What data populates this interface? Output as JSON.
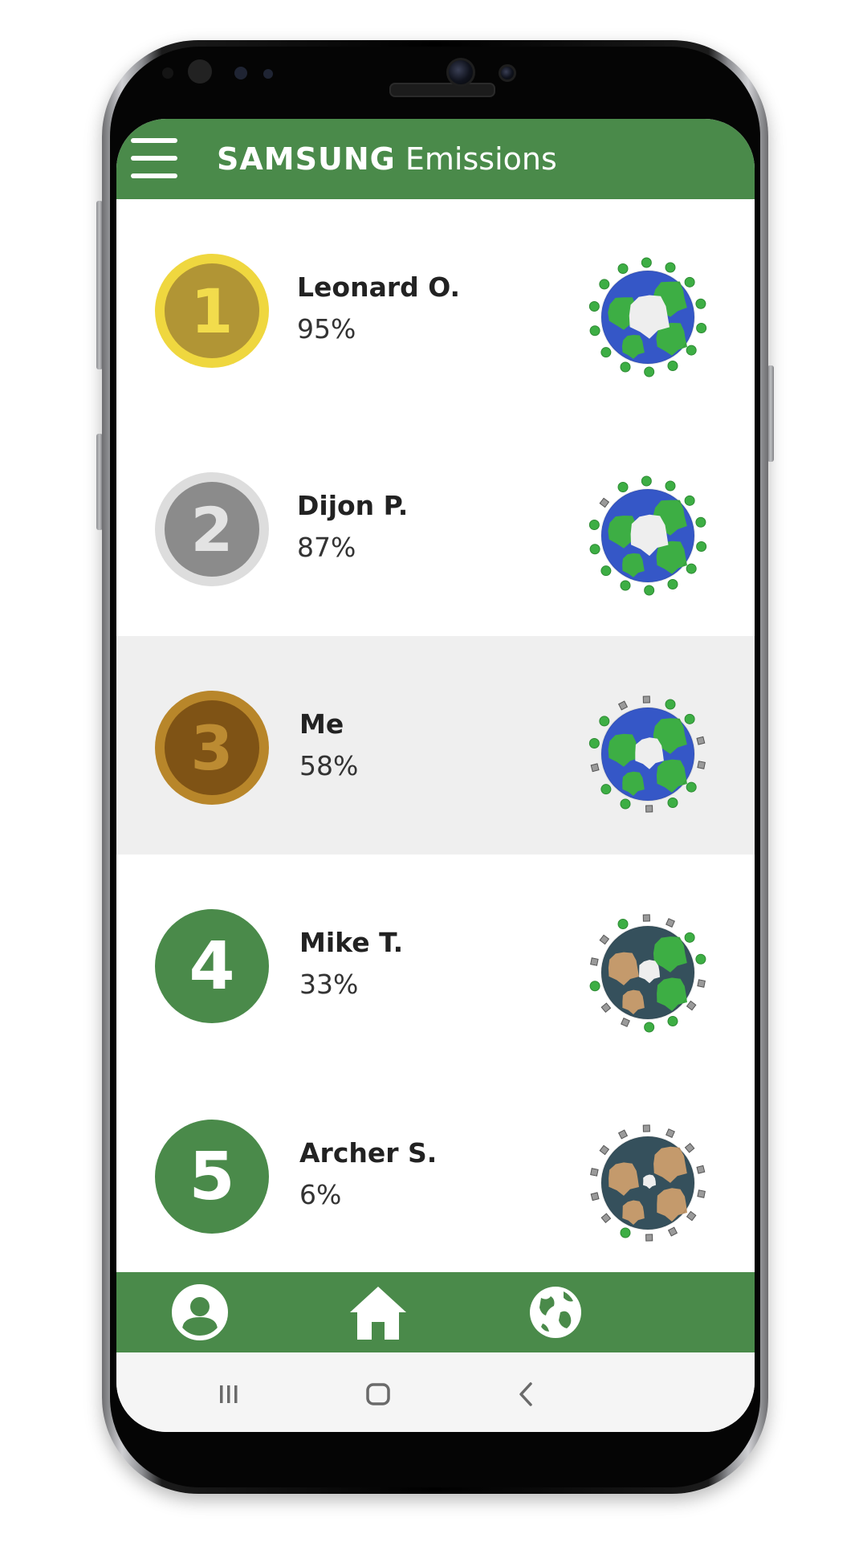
{
  "header": {
    "brand": "SAMSUNG",
    "title": "Emissions",
    "menu_icon": "hamburger-menu-icon"
  },
  "leaderboard": [
    {
      "rank": "1",
      "name": "Leonard O.",
      "score": "95%",
      "score_value": 95,
      "medal": "gold"
    },
    {
      "rank": "2",
      "name": "Dijon P.",
      "score": "87%",
      "score_value": 87,
      "medal": "silver"
    },
    {
      "rank": "3",
      "name": "Me",
      "score": "58%",
      "score_value": 58,
      "medal": "bronze",
      "highlighted": true
    },
    {
      "rank": "4",
      "name": "Mike T.",
      "score": "33%",
      "score_value": 33,
      "medal": "plain"
    },
    {
      "rank": "5",
      "name": "Archer S.",
      "score": "6%",
      "score_value": 6,
      "medal": "plain"
    }
  ],
  "bottom_nav": {
    "items": [
      "profile-icon",
      "home-icon",
      "globe-icon"
    ]
  },
  "system_nav": {
    "items": [
      "recent-apps-icon",
      "home-button-icon",
      "back-icon"
    ]
  },
  "colors": {
    "primary_green": "#4a8a4a",
    "ocean_blue": "#3557c7",
    "land_green": "#3dae44",
    "polluted_ocean": "#35505c",
    "barren_land": "#c49a6c",
    "gold": "#efd73f",
    "silver": "#dddddd",
    "bronze": "#b8862a"
  }
}
